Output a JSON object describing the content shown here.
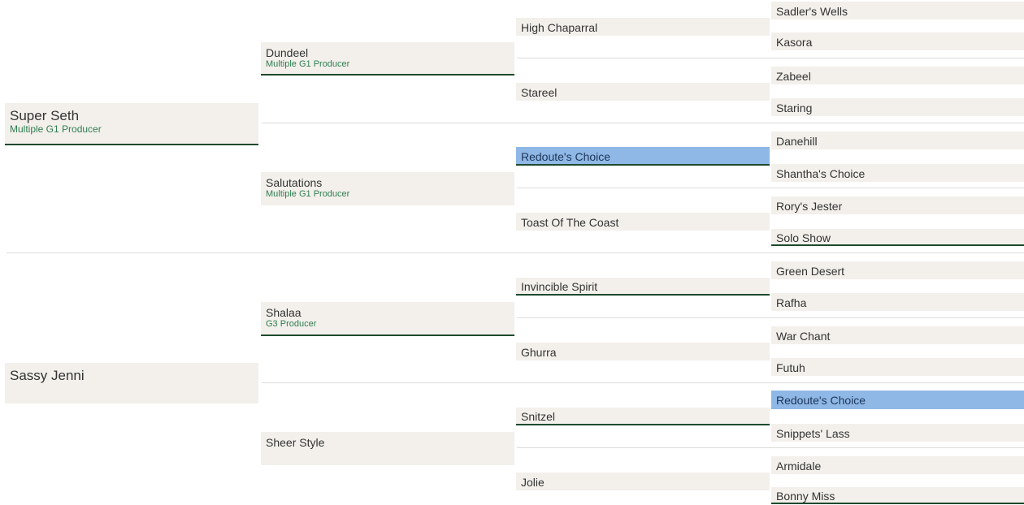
{
  "sire": {
    "name": "Super Seth",
    "note": "Multiple G1 Producer",
    "sire": {
      "name": "Dundeel",
      "note": "Multiple G1 Producer",
      "sire": {
        "name": "High Chaparral",
        "sire": "Sadler's Wells",
        "dam": "Kasora"
      },
      "dam": {
        "name": "Stareel",
        "sire": "Zabeel",
        "dam": "Staring"
      }
    },
    "dam": {
      "name": "Salutations",
      "note": "Multiple G1 Producer",
      "sire": {
        "name": "Redoute's Choice",
        "sire": "Danehill",
        "dam": "Shantha's Choice"
      },
      "dam": {
        "name": "Toast Of The Coast",
        "sire": "Rory's Jester",
        "dam": "Solo Show"
      }
    }
  },
  "dam": {
    "name": "Sassy Jenni",
    "sire": {
      "name": "Shalaa",
      "note": "G3 Producer",
      "sire": {
        "name": "Invincible Spirit",
        "sire": "Green Desert",
        "dam": "Rafha"
      },
      "dam": {
        "name": "Ghurra",
        "sire": "War Chant",
        "dam": "Futuh"
      }
    },
    "dam": {
      "name": "Sheer Style",
      "sire": {
        "name": "Snitzel",
        "sire": "Redoute's Choice",
        "dam": "Snippets' Lass"
      },
      "dam": {
        "name": "Jolie",
        "sire": "Armidale",
        "dam": "Bonny Miss"
      }
    }
  },
  "colors": {
    "cell_bg": "#f3f0ec",
    "highlight": "#8fb8e6",
    "underline": "#1e4a2e",
    "producer_text": "#2e7d4f"
  }
}
